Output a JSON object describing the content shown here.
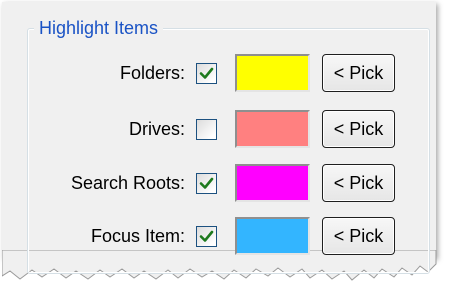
{
  "group": {
    "title": "Highlight Items"
  },
  "rows": [
    {
      "label": "Folders:",
      "checked": true,
      "color": "#ffff00",
      "pick_label": "< Pick"
    },
    {
      "label": "Drives:",
      "checked": false,
      "color": "#ff8080",
      "pick_label": "< Pick"
    },
    {
      "label": "Search Roots:",
      "checked": true,
      "color": "#ff00ff",
      "pick_label": "< Pick"
    },
    {
      "label": "Focus Item:",
      "checked": true,
      "color": "#33b5ff",
      "pick_label": "< Pick"
    }
  ]
}
